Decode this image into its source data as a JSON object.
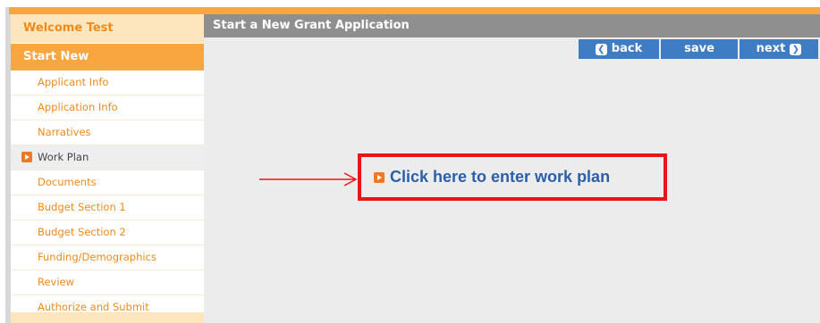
{
  "sidebar": {
    "welcome": "Welcome Test",
    "section_title": "Start New",
    "items": [
      {
        "label": "Applicant Info",
        "active": false
      },
      {
        "label": "Application Info",
        "active": false
      },
      {
        "label": "Narratives",
        "active": false
      },
      {
        "label": "Work Plan",
        "active": true
      },
      {
        "label": "Documents",
        "active": false
      },
      {
        "label": "Budget Section 1",
        "active": false
      },
      {
        "label": "Budget Section 2",
        "active": false
      },
      {
        "label": "Funding/Demographics",
        "active": false
      },
      {
        "label": "Review",
        "active": false
      },
      {
        "label": "Authorize and Submit",
        "active": false
      }
    ]
  },
  "main": {
    "title": "Start a New Grant Application",
    "toolbar": {
      "back_label": "back",
      "save_label": "save",
      "next_label": "next"
    },
    "callout": {
      "link_text": "Click here to enter work plan"
    }
  },
  "colors": {
    "accent_orange": "#f7a640",
    "header_gray": "#8f8f8f",
    "button_blue": "#3e7cc4",
    "link_blue": "#2a5faa",
    "highlight_red": "#e8141a"
  },
  "icons": {
    "nav_active": "arrow-right-icon",
    "back": "chevron-left-icon",
    "next": "chevron-right-icon",
    "callout": "arrow-right-icon",
    "annotation": "pointer-arrow-icon"
  }
}
